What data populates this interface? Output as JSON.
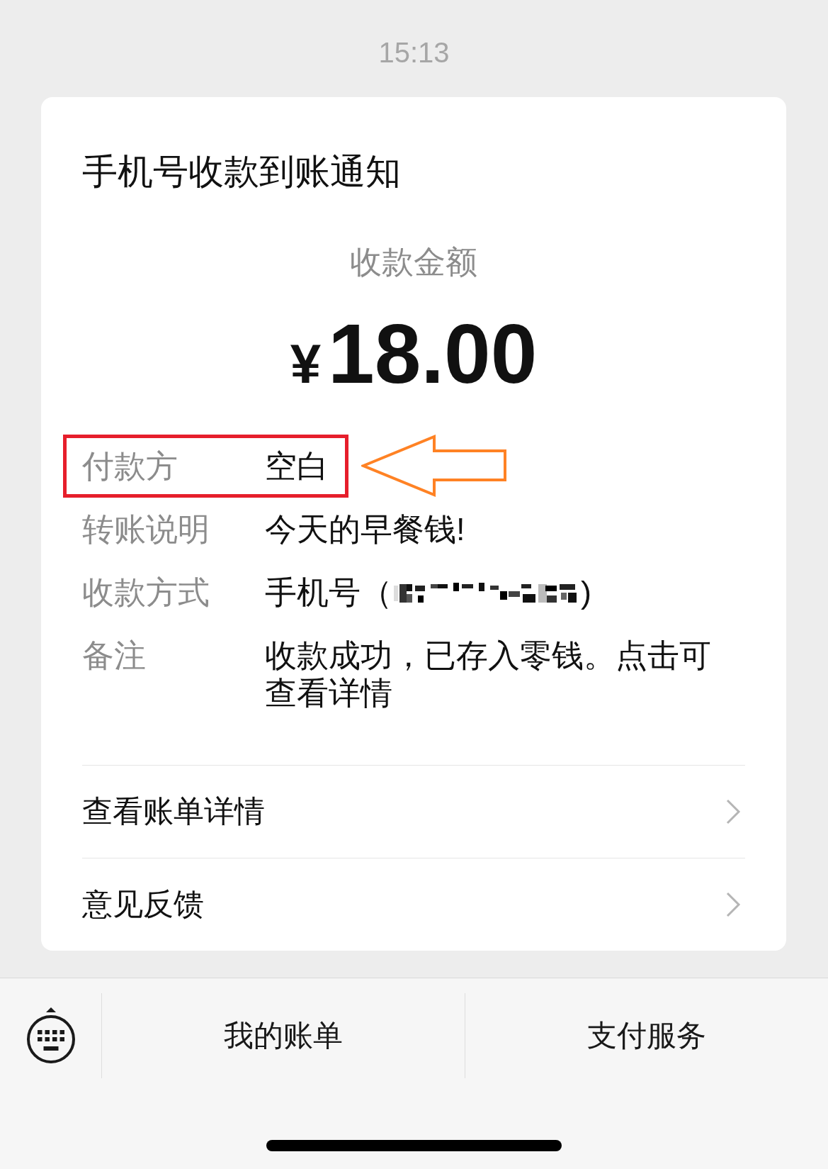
{
  "status_bar": {
    "time": "15:13"
  },
  "card": {
    "title": "手机号收款到账通知",
    "amount_label": "收款金额",
    "currency": "¥",
    "amount": "18.00",
    "details": [
      {
        "kind": "text",
        "label": "付款方",
        "value": "空白",
        "highlighted": true
      },
      {
        "kind": "text",
        "label": "转账说明",
        "value": "今天的早餐钱!",
        "highlighted": false
      },
      {
        "kind": "redacted",
        "label": "收款方式",
        "value": "手机号（",
        "suffix": ")",
        "highlighted": false
      },
      {
        "kind": "text",
        "label": "备注",
        "value": "收款成功，已存入零钱。点击可查看详情",
        "highlighted": false
      }
    ],
    "links": [
      {
        "label": "查看账单详情"
      },
      {
        "label": "意见反馈"
      }
    ]
  },
  "bottom_bar": {
    "items": [
      {
        "label": "我的账单"
      },
      {
        "label": "支付服务"
      }
    ]
  }
}
